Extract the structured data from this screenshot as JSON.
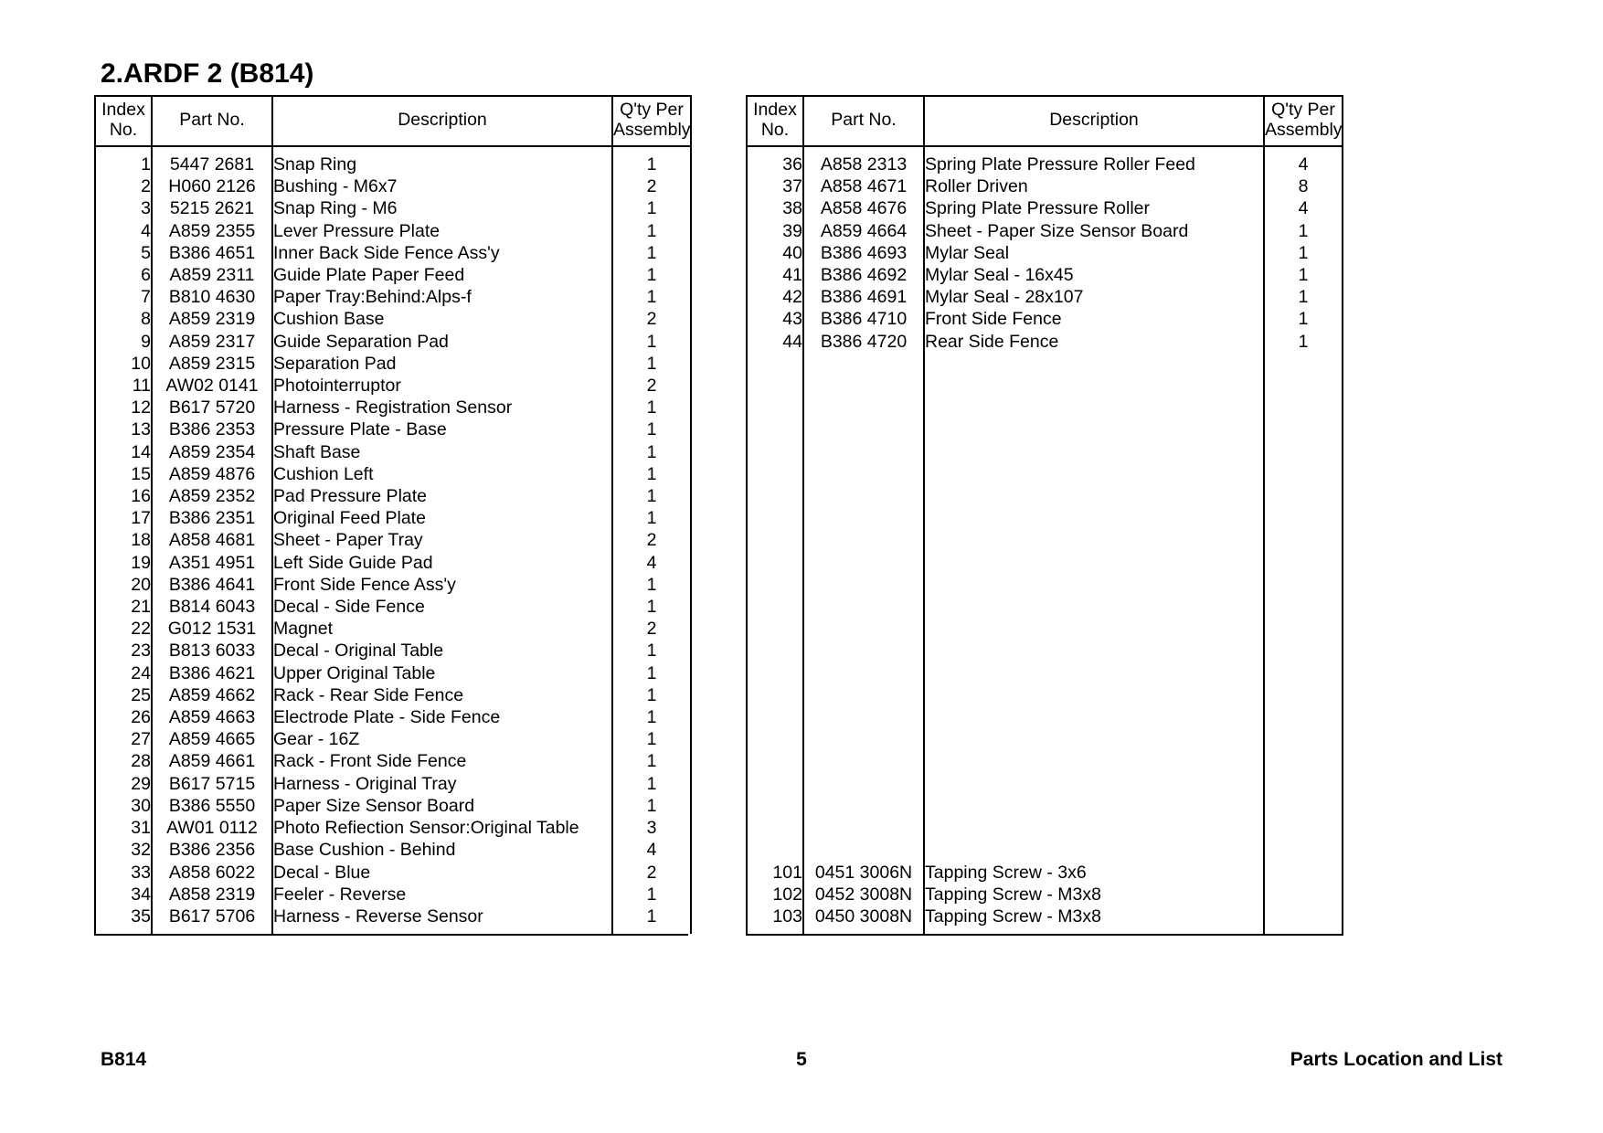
{
  "document": {
    "section_title": "2.ARDF 2 (B814)"
  },
  "columns": {
    "index_line1": "Index",
    "index_line2": "No.",
    "part_no": "Part No.",
    "description": "Description",
    "qty_line1": "Q'ty Per",
    "qty_line2": "Assembly"
  },
  "left_table": {
    "rows": [
      {
        "index": "1",
        "part_no": "5447 2681",
        "description": "Snap Ring",
        "qty": "1"
      },
      {
        "index": "2",
        "part_no": "H060 2126",
        "description": "Bushing - M6x7",
        "qty": "2"
      },
      {
        "index": "3",
        "part_no": "5215 2621",
        "description": "Snap Ring - M6",
        "qty": "1"
      },
      {
        "index": "4",
        "part_no": "A859 2355",
        "description": "Lever Pressure Plate",
        "qty": "1"
      },
      {
        "index": "5",
        "part_no": "B386 4651",
        "description": "Inner Back Side Fence Ass'y",
        "qty": "1"
      },
      {
        "index": "6",
        "part_no": "A859 2311",
        "description": "Guide Plate Paper Feed",
        "qty": "1"
      },
      {
        "index": "7",
        "part_no": "B810 4630",
        "description": "Paper Tray:Behind:Alps-f",
        "qty": "1"
      },
      {
        "index": "8",
        "part_no": "A859 2319",
        "description": "Cushion Base",
        "qty": "2"
      },
      {
        "index": "9",
        "part_no": "A859 2317",
        "description": "Guide Separation Pad",
        "qty": "1"
      },
      {
        "index": "10",
        "part_no": "A859 2315",
        "description": "Separation Pad",
        "qty": "1"
      },
      {
        "index": "11",
        "part_no": "AW02 0141",
        "description": "Photointerruptor",
        "qty": "2"
      },
      {
        "index": "12",
        "part_no": "B617 5720",
        "description": "Harness - Registration Sensor",
        "qty": "1"
      },
      {
        "index": "13",
        "part_no": "B386 2353",
        "description": "Pressure Plate - Base",
        "qty": "1"
      },
      {
        "index": "14",
        "part_no": "A859 2354",
        "description": "Shaft Base",
        "qty": "1"
      },
      {
        "index": "15",
        "part_no": "A859 4876",
        "description": "Cushion Left",
        "qty": "1"
      },
      {
        "index": "16",
        "part_no": "A859 2352",
        "description": "Pad Pressure Plate",
        "qty": "1"
      },
      {
        "index": "17",
        "part_no": "B386 2351",
        "description": "Original Feed Plate",
        "qty": "1"
      },
      {
        "index": "18",
        "part_no": "A858 4681",
        "description": "Sheet - Paper Tray",
        "qty": "2"
      },
      {
        "index": "19",
        "part_no": "A351 4951",
        "description": "Left Side Guide Pad",
        "qty": "4"
      },
      {
        "index": "20",
        "part_no": "B386 4641",
        "description": "Front Side Fence Ass'y",
        "qty": "1"
      },
      {
        "index": "21",
        "part_no": "B814 6043",
        "description": "Decal - Side Fence",
        "qty": "1"
      },
      {
        "index": "22",
        "part_no": "G012 1531",
        "description": "Magnet",
        "qty": "2"
      },
      {
        "index": "23",
        "part_no": "B813 6033",
        "description": "Decal - Original Table",
        "qty": "1"
      },
      {
        "index": "24",
        "part_no": "B386 4621",
        "description": "Upper Original Table",
        "qty": "1"
      },
      {
        "index": "25",
        "part_no": "A859 4662",
        "description": "Rack - Rear Side Fence",
        "qty": "1"
      },
      {
        "index": "26",
        "part_no": "A859 4663",
        "description": "Electrode Plate - Side Fence",
        "qty": "1"
      },
      {
        "index": "27",
        "part_no": "A859 4665",
        "description": "Gear - 16Z",
        "qty": "1"
      },
      {
        "index": "28",
        "part_no": "A859 4661",
        "description": "Rack - Front Side Fence",
        "qty": "1"
      },
      {
        "index": "29",
        "part_no": "B617 5715",
        "description": "Harness - Original Tray",
        "qty": "1"
      },
      {
        "index": "30",
        "part_no": "B386 5550",
        "description": "Paper Size Sensor Board",
        "qty": "1"
      },
      {
        "index": "31",
        "part_no": "AW01 0112",
        "description": "Photo Refiection Sensor:Original Table",
        "qty": "3"
      },
      {
        "index": "32",
        "part_no": "B386 2356",
        "description": "Base Cushion - Behind",
        "qty": "4"
      },
      {
        "index": "33",
        "part_no": "A858 6022",
        "description": "Decal - Blue",
        "qty": "2"
      },
      {
        "index": "34",
        "part_no": "A858 2319",
        "description": "Feeler - Reverse",
        "qty": "1"
      },
      {
        "index": "35",
        "part_no": "B617 5706",
        "description": "Harness - Reverse Sensor",
        "qty": "1"
      }
    ]
  },
  "right_table": {
    "rows": [
      {
        "index": "36",
        "part_no": "A858 2313",
        "description": "Spring Plate Pressure Roller Feed",
        "qty": "4"
      },
      {
        "index": "37",
        "part_no": "A858 4671",
        "description": "Roller Driven",
        "qty": "8"
      },
      {
        "index": "38",
        "part_no": "A858 4676",
        "description": "Spring Plate Pressure Roller",
        "qty": "4"
      },
      {
        "index": "39",
        "part_no": "A859 4664",
        "description": "Sheet - Paper Size Sensor Board",
        "qty": "1"
      },
      {
        "index": "40",
        "part_no": "B386 4693",
        "description": "Mylar Seal",
        "qty": "1"
      },
      {
        "index": "41",
        "part_no": "B386 4692",
        "description": "Mylar Seal - 16x45",
        "qty": "1"
      },
      {
        "index": "42",
        "part_no": "B386 4691",
        "description": "Mylar Seal - 28x107",
        "qty": "1"
      },
      {
        "index": "43",
        "part_no": "B386 4710",
        "description": "Front Side Fence",
        "qty": "1"
      },
      {
        "index": "44",
        "part_no": "B386 4720",
        "description": "Rear Side Fence",
        "qty": "1"
      },
      {
        "index": "",
        "part_no": "",
        "description": "",
        "qty": ""
      },
      {
        "index": "",
        "part_no": "",
        "description": "",
        "qty": ""
      },
      {
        "index": "",
        "part_no": "",
        "description": "",
        "qty": ""
      },
      {
        "index": "",
        "part_no": "",
        "description": "",
        "qty": ""
      },
      {
        "index": "",
        "part_no": "",
        "description": "",
        "qty": ""
      },
      {
        "index": "",
        "part_no": "",
        "description": "",
        "qty": ""
      },
      {
        "index": "",
        "part_no": "",
        "description": "",
        "qty": ""
      },
      {
        "index": "",
        "part_no": "",
        "description": "",
        "qty": ""
      },
      {
        "index": "",
        "part_no": "",
        "description": "",
        "qty": ""
      },
      {
        "index": "",
        "part_no": "",
        "description": "",
        "qty": ""
      },
      {
        "index": "",
        "part_no": "",
        "description": "",
        "qty": ""
      },
      {
        "index": "",
        "part_no": "",
        "description": "",
        "qty": ""
      },
      {
        "index": "",
        "part_no": "",
        "description": "",
        "qty": ""
      },
      {
        "index": "",
        "part_no": "",
        "description": "",
        "qty": ""
      },
      {
        "index": "",
        "part_no": "",
        "description": "",
        "qty": ""
      },
      {
        "index": "",
        "part_no": "",
        "description": "",
        "qty": ""
      },
      {
        "index": "",
        "part_no": "",
        "description": "",
        "qty": ""
      },
      {
        "index": "",
        "part_no": "",
        "description": "",
        "qty": ""
      },
      {
        "index": "",
        "part_no": "",
        "description": "",
        "qty": ""
      },
      {
        "index": "",
        "part_no": "",
        "description": "",
        "qty": ""
      },
      {
        "index": "",
        "part_no": "",
        "description": "",
        "qty": ""
      },
      {
        "index": "",
        "part_no": "",
        "description": "",
        "qty": ""
      },
      {
        "index": "",
        "part_no": "",
        "description": "",
        "qty": ""
      },
      {
        "index": "101",
        "part_no": "0451 3006N",
        "description": "Tapping Screw - 3x6",
        "qty": ""
      },
      {
        "index": "102",
        "part_no": "0452 3008N",
        "description": "Tapping Screw - M3x8",
        "qty": ""
      },
      {
        "index": "103",
        "part_no": "0450 3008N",
        "description": "Tapping Screw - M3x8",
        "qty": ""
      }
    ]
  },
  "footer": {
    "left": "B814",
    "page_number": "5",
    "right": "Parts Location and List"
  }
}
